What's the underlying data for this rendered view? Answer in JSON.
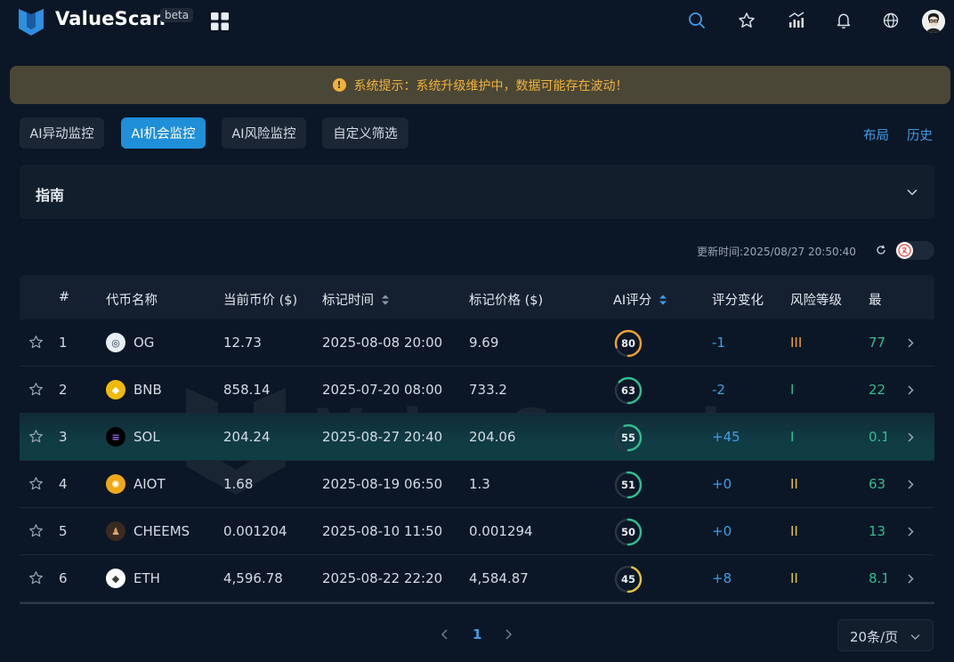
{
  "header": {
    "brand": "ValueScan",
    "badge": "beta",
    "icons": [
      "apps-icon",
      "search-icon",
      "star-icon",
      "chart-icon",
      "bell-icon",
      "globe-icon",
      "avatar"
    ]
  },
  "notice": {
    "text": "系统提示：系统升级维护中，数据可能存在波动！"
  },
  "tabs": [
    {
      "label": "AI异动监控",
      "active": false
    },
    {
      "label": "AI机会监控",
      "active": true
    },
    {
      "label": "AI风险监控",
      "active": false
    },
    {
      "label": "自定义筛选",
      "active": false
    }
  ],
  "top_links": {
    "layout": "布局",
    "history": "历史"
  },
  "guide": {
    "title": "指南"
  },
  "update": {
    "text": "更新时间:2025/08/27 20:50:40"
  },
  "table": {
    "columns": {
      "num": "#",
      "name": "代币名称",
      "price": "当前币价 ($)",
      "mark_time": "标记时间",
      "mark_price": "标记价格 ($)",
      "ai_score": "AI评分",
      "score_change": "评分变化",
      "risk": "风险等级",
      "max": "最"
    },
    "rows": [
      {
        "num": "1",
        "name": "OG",
        "price": "12.73",
        "mark_time": "2025-08-08 20:00",
        "mark_price": "9.69",
        "score": "80",
        "change": "-1",
        "risk": "III",
        "max": "77."
      },
      {
        "num": "2",
        "name": "BNB",
        "price": "858.14",
        "mark_time": "2025-07-20 08:00",
        "mark_price": "733.2",
        "score": "63",
        "change": "-2",
        "risk": "I",
        "max": "22"
      },
      {
        "num": "3",
        "name": "SOL",
        "price": "204.24",
        "mark_time": "2025-08-27 20:40",
        "mark_price": "204.06",
        "score": "55",
        "change": "+45",
        "risk": "I",
        "max": "0.1"
      },
      {
        "num": "4",
        "name": "AIOT",
        "price": "1.68",
        "mark_time": "2025-08-19 06:50",
        "mark_price": "1.3",
        "score": "51",
        "change": "+0",
        "risk": "II",
        "max": "63"
      },
      {
        "num": "5",
        "name": "CHEEMS",
        "price": "0.001204",
        "mark_time": "2025-08-10 11:50",
        "mark_price": "0.001294",
        "score": "50",
        "change": "+0",
        "risk": "II",
        "max": "13."
      },
      {
        "num": "6",
        "name": "ETH",
        "price": "4,596.78",
        "mark_time": "2025-08-22 22:20",
        "mark_price": "4,584.87",
        "score": "45",
        "change": "+8",
        "risk": "II",
        "max": "8.1"
      }
    ]
  },
  "watermark": {
    "text": "ValueScan.io"
  },
  "pagination": {
    "current_page": "1",
    "page_size": "20条/页"
  },
  "colors": {
    "accent": "#1f8fd8",
    "link": "#3f9ee8",
    "risk_high": "#f0a030",
    "risk_mid": "#e8c53a",
    "risk_low": "#2fbf8f",
    "gauge_orange": "#f0a030",
    "gauge_teal": "#2fbf8f",
    "gauge_yellow": "#e8c53a"
  }
}
